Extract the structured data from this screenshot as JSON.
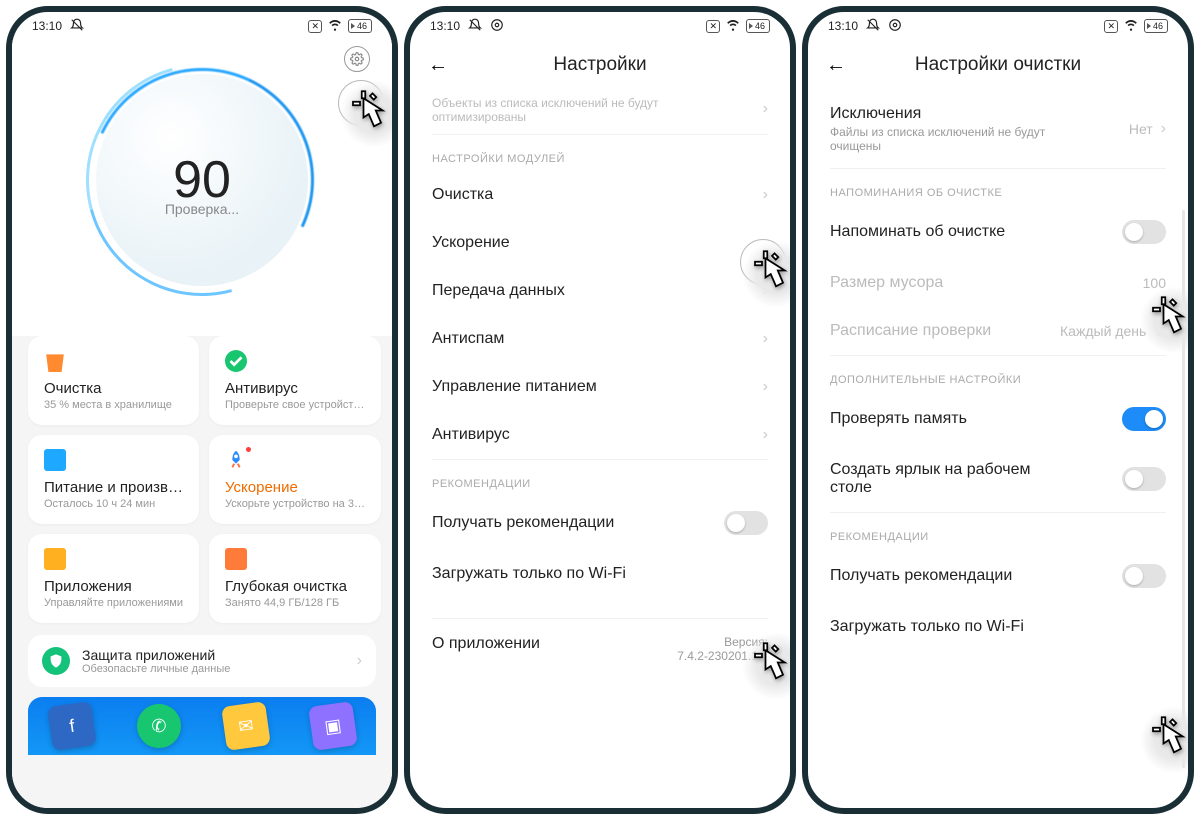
{
  "status": {
    "time": "13:10",
    "battery": "46"
  },
  "phone1": {
    "score": "90",
    "scoreLabel": "Проверка...",
    "cards": {
      "clean": {
        "title": "Очистка",
        "sub": "35 % места в хранилище"
      },
      "antivirus": {
        "title": "Антивирус",
        "sub": "Проверьте свое устройст…"
      },
      "power": {
        "title": "Питание и произв…",
        "sub": "Осталось 10 ч 24 мин"
      },
      "boost": {
        "title": "Ускорение",
        "sub": "Ускорьте устройство на 3…"
      },
      "apps": {
        "title": "Приложения",
        "sub": "Управляйте приложениями"
      },
      "deep": {
        "title": "Глубокая очистка",
        "sub": "Занято 44,9 ГБ/128 ГБ"
      }
    },
    "banner": {
      "title": "Защита приложений",
      "sub": "Обезопасьте личные данные"
    }
  },
  "phone2": {
    "title": "Настройки",
    "exclNote": "Объекты из списка исключений не будут оптимизированы",
    "secModules": "НАСТРОЙКИ МОДУЛЕЙ",
    "items": {
      "clean": "Очистка",
      "boost": "Ускорение",
      "data": "Передача данных",
      "antispam": "Антиспам",
      "power": "Управление питанием",
      "antivirus": "Антивирус"
    },
    "secRecs": "РЕКОМЕНДАЦИИ",
    "rec": "Получать рекомендации",
    "wifi": "Загружать только по Wi-Fi",
    "aboutLabel": "О приложении",
    "versionLabel": "Версия:",
    "version": "7.4.2-230201.1.2"
  },
  "phone3": {
    "title": "Настройки очистки",
    "exclTitle": "Исключения",
    "exclSub": "Файлы из списка исключений не будут очищены",
    "exclValue": "Нет",
    "secReminders": "НАПОМИНАНИЯ ОБ ОЧИСТКЕ",
    "remind": "Напоминать об очистке",
    "trashSize": "Размер мусора",
    "trashSizeVal": "100",
    "schedule": "Расписание проверки",
    "scheduleVal": "Каждый день",
    "secExtra": "ДОПОЛНИТЕЛЬНЫЕ НАСТРОЙКИ",
    "checkMem": "Проверять память",
    "shortcut": "Создать ярлык на рабочем столе",
    "secRecs": "РЕКОМЕНДАЦИИ",
    "rec": "Получать рекомендации",
    "wifi": "Загружать только по Wi-Fi"
  }
}
